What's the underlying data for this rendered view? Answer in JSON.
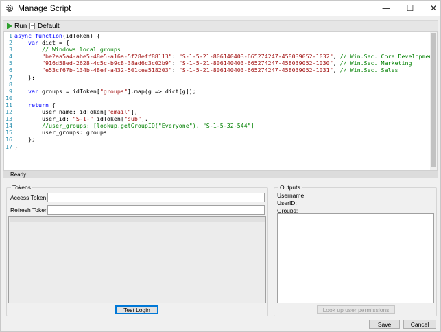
{
  "window": {
    "title": "Manage Script",
    "minimize_glyph": "—",
    "maximize_glyph": "☐",
    "close_glyph": "✕"
  },
  "toolbar": {
    "run_label": "Run",
    "default_label": "Default",
    "run_icon": "play-icon",
    "default_icon": "document-icon"
  },
  "editor": {
    "lines": [
      {
        "num": "1",
        "parts": [
          [
            "kw",
            "async function"
          ],
          [
            "t",
            "(idToken) {"
          ]
        ]
      },
      {
        "num": "2",
        "parts": [
          [
            "t",
            "    "
          ],
          [
            "kw",
            "var"
          ],
          [
            "t",
            " dict = {"
          ]
        ]
      },
      {
        "num": "3",
        "parts": [
          [
            "t",
            "        "
          ],
          [
            "cmt",
            "// Windows local groups"
          ]
        ]
      },
      {
        "num": "4",
        "parts": [
          [
            "t",
            "        "
          ],
          [
            "str",
            "\"be2aa5a4-abe5-48e5-a16a-5f28eff88113\""
          ],
          [
            "t",
            ": "
          ],
          [
            "str",
            "\"S-1-5-21-806140403-665274247-458039052-1032\""
          ],
          [
            "t",
            ", "
          ],
          [
            "cmt",
            "// Win.Sec. Core Development"
          ]
        ]
      },
      {
        "num": "5",
        "parts": [
          [
            "t",
            "        "
          ],
          [
            "str",
            "\"916d58ed-2628-4c5c-b9c8-38ad6c3c02b9\""
          ],
          [
            "t",
            ": "
          ],
          [
            "str",
            "\"S-1-5-21-806140403-665274247-458039052-1030\""
          ],
          [
            "t",
            ", "
          ],
          [
            "cmt",
            "// Win.Sec. Marketing"
          ]
        ]
      },
      {
        "num": "6",
        "parts": [
          [
            "t",
            "        "
          ],
          [
            "str",
            "\"e53cf67b-134b-48ef-a432-501cea518203\""
          ],
          [
            "t",
            ": "
          ],
          [
            "str",
            "\"S-1-5-21-806140403-665274247-458039052-1031\""
          ],
          [
            "t",
            ", "
          ],
          [
            "cmt",
            "// Win.Sec. Sales"
          ]
        ]
      },
      {
        "num": "7",
        "parts": [
          [
            "t",
            "    };"
          ]
        ]
      },
      {
        "num": "8",
        "parts": [
          [
            "t",
            ""
          ]
        ]
      },
      {
        "num": "9",
        "parts": [
          [
            "t",
            "    "
          ],
          [
            "kw",
            "var"
          ],
          [
            "t",
            " groups = idToken["
          ],
          [
            "str",
            "\"groups\""
          ],
          [
            "t",
            "].map(g => dict[g]);"
          ]
        ]
      },
      {
        "num": "10",
        "parts": [
          [
            "t",
            ""
          ]
        ]
      },
      {
        "num": "11",
        "parts": [
          [
            "t",
            "    "
          ],
          [
            "kw",
            "return"
          ],
          [
            "t",
            " {"
          ]
        ]
      },
      {
        "num": "12",
        "parts": [
          [
            "t",
            "        user_name: idToken["
          ],
          [
            "str",
            "\"email\""
          ],
          [
            "t",
            "],"
          ]
        ]
      },
      {
        "num": "13",
        "parts": [
          [
            "t",
            "        user_id: "
          ],
          [
            "str",
            "\"S-1-\""
          ],
          [
            "t",
            "+idToken["
          ],
          [
            "str",
            "\"sub\""
          ],
          [
            "t",
            "],"
          ]
        ]
      },
      {
        "num": "14",
        "parts": [
          [
            "t",
            "        "
          ],
          [
            "cmt",
            "//user_groups: [lookup.getGroupID(\"Everyone\"), \"S-1-5-32-544\"]"
          ]
        ]
      },
      {
        "num": "15",
        "parts": [
          [
            "t",
            "        user_groups: groups"
          ]
        ]
      },
      {
        "num": "16",
        "parts": [
          [
            "t",
            "    };"
          ]
        ]
      },
      {
        "num": "17",
        "parts": [
          [
            "t",
            "}"
          ]
        ]
      }
    ]
  },
  "status": {
    "text": "Ready"
  },
  "tokens": {
    "title": "Tokens",
    "access_token_label": "Access Token:",
    "access_token_value": "",
    "refresh_token_label": "Refresh Token:",
    "refresh_token_value": "",
    "test_login_label": "Test Login"
  },
  "outputs": {
    "title": "Outputs",
    "username_label": "Username:",
    "userid_label": "UserID:",
    "groups_label": "Groups:",
    "lookup_label": "Look up user permissions"
  },
  "footer": {
    "save_label": "Save",
    "cancel_label": "Cancel"
  }
}
